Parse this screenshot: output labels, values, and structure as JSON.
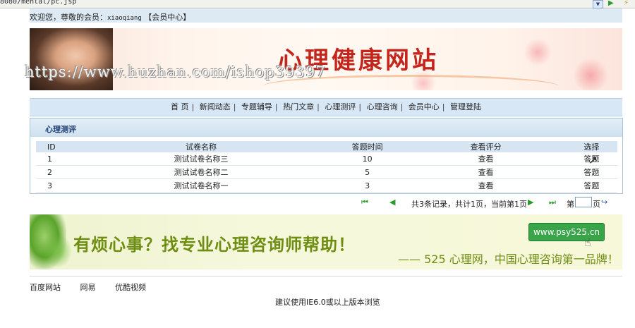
{
  "browser": {
    "url": "8080/mental/pc.jsp",
    "dropdown_icon": "chevron-down-icon",
    "go_icon": "go-arrow-icon"
  },
  "welcome": {
    "prefix": "欢迎您，尊敬的会员：",
    "username": "xiaoqiang",
    "member_center": "【会员中心】"
  },
  "banner": {
    "title": "心理健康网站",
    "watermark": "https://www.huzhan.com/ishop39397"
  },
  "nav": {
    "items": [
      "首 页",
      "新闻动态",
      "专题辅导",
      "热门文章",
      "心理测评",
      "心理咨询",
      "会员中心",
      "管理登陆"
    ],
    "separator": "|"
  },
  "panel": {
    "title": "心理测评",
    "columns": [
      "ID",
      "试卷名称",
      "答题时间",
      "查看评分",
      "选择"
    ],
    "rows": [
      {
        "id": "1",
        "name": "测试试卷名称三",
        "time": "10",
        "view": "查看",
        "action": "答题"
      },
      {
        "id": "2",
        "name": "测试试卷名称二",
        "time": "5",
        "view": "查看",
        "action": "答题"
      },
      {
        "id": "3",
        "name": "测试试卷名称一",
        "time": "3",
        "view": "查看",
        "action": "答题"
      }
    ]
  },
  "pager": {
    "first": "⏮",
    "prev": "◀",
    "info": "共3条记录，共计1页，当前第1页",
    "next": "▶",
    "last": "⏭",
    "label_di": "第",
    "page_value": "",
    "label_ye": "页",
    "go": "↪"
  },
  "ad": {
    "headline": "有烦心事？找专业心理咨询师帮助！",
    "url": "www.psy525.cn",
    "tagline": "—— 525 心理网，中国心理咨询第一品牌！"
  },
  "footer": {
    "links": [
      "百度网站",
      "网易",
      "优酷视频"
    ],
    "note": "建议使用IE6.0或以上版本浏览"
  },
  "colors": {
    "accent_red": "#c4261d",
    "nav_bg": "#d7e7f6",
    "panel_title": "#1d3f72",
    "pager_green": "#2a9a2a",
    "ad_green": "#6e8e12"
  }
}
